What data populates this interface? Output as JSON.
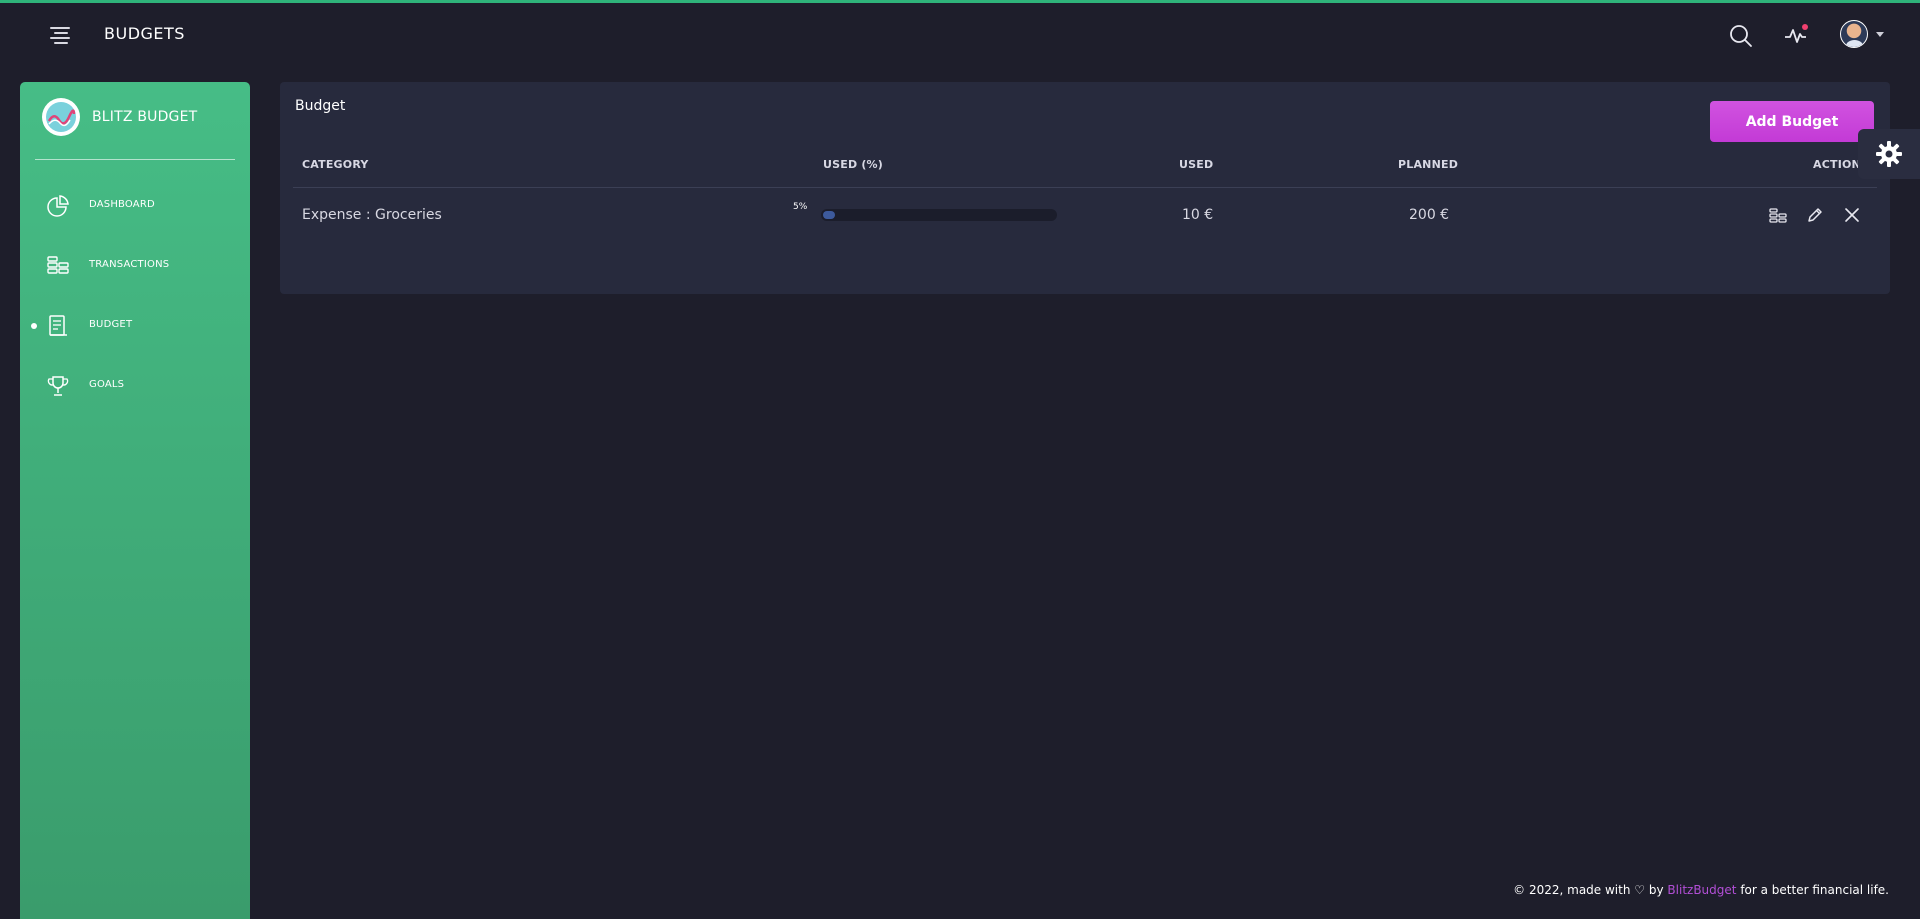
{
  "topbar": {
    "title": "BUDGETS"
  },
  "sidebar": {
    "brand": "BLITZ BUDGET",
    "items": [
      {
        "label": "DASHBOARD",
        "icon": "pie-chart-icon",
        "active": false
      },
      {
        "label": "TRANSACTIONS",
        "icon": "coins-icon",
        "active": false
      },
      {
        "label": "BUDGET",
        "icon": "receipt-icon",
        "active": true
      },
      {
        "label": "GOALS",
        "icon": "trophy-icon",
        "active": false
      }
    ]
  },
  "card": {
    "title": "Budget",
    "add_button": "Add Budget",
    "columns": [
      "CATEGORY",
      "USED (%)",
      "USED",
      "PLANNED",
      "ACTIONS"
    ],
    "rows": [
      {
        "category": "Expense : Groceries",
        "used_pct_label": "5%",
        "used_pct": 5,
        "used": "10 €",
        "planned": "200 €"
      }
    ]
  },
  "footer": {
    "prefix": "© 2022, made with",
    "by": "by",
    "brand": "BlitzBudget",
    "suffix": "for a better financial life."
  },
  "colors": {
    "sidebar": "#46bd86",
    "accent_button": "#c94ade",
    "background": "#1e1e2b",
    "card": "#272a3d"
  }
}
